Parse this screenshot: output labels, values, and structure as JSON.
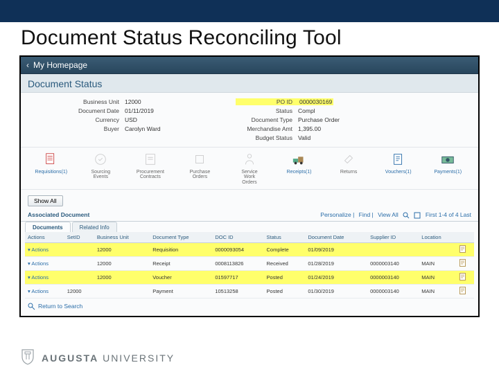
{
  "slide_title": "Document Status Reconciling Tool",
  "app": {
    "homepage_label": "My Homepage",
    "page_heading": "Document Status"
  },
  "fields": {
    "business_unit": {
      "label": "Business Unit",
      "value": "12000"
    },
    "document_date": {
      "label": "Document Date",
      "value": "01/11/2019"
    },
    "currency": {
      "label": "Currency",
      "value": "USD"
    },
    "buyer": {
      "label": "Buyer",
      "value": "Carolyn Ward"
    },
    "po_id": {
      "label": "PO ID",
      "value": "0000030169"
    },
    "status": {
      "label": "Status",
      "value": "Compl"
    },
    "document_type": {
      "label": "Document Type",
      "value": "Purchase Order"
    },
    "merch_amt": {
      "label": "Merchandise Amt",
      "value": "1,395.00"
    },
    "budget_status": {
      "label": "Budget Status",
      "value": "Valid"
    }
  },
  "flow": [
    {
      "label": "Requisitions(1)",
      "active": true,
      "dim": false
    },
    {
      "label": "Sourcing\nEvents",
      "active": false,
      "dim": true
    },
    {
      "label": "Procurement\nContracts",
      "active": false,
      "dim": true
    },
    {
      "label": "Purchase\nOrders",
      "active": false,
      "dim": true
    },
    {
      "label": "Service\nWork\nOrders",
      "active": false,
      "dim": true
    },
    {
      "label": "Receipts(1)",
      "active": true,
      "dim": false
    },
    {
      "label": "Returns",
      "active": false,
      "dim": true
    },
    {
      "label": "Vouchers(1)",
      "active": true,
      "dim": false
    },
    {
      "label": "Payments(1)",
      "active": true,
      "dim": false
    }
  ],
  "buttons": {
    "show_all": "Show All",
    "return_to_search": "Return to Search"
  },
  "assoc": {
    "title": "Associated Document",
    "tools": {
      "personalize": "Personalize",
      "find": "Find",
      "view_all": "View All",
      "pager": "First   1-4 of 4   Last"
    }
  },
  "tabs": {
    "documents": "Documents",
    "related_info": "Related Info"
  },
  "table": {
    "headers": [
      "Actions",
      "SetID",
      "Business Unit",
      "Document Type",
      "DOC ID",
      "Status",
      "Document Date",
      "Supplier ID",
      "Location"
    ],
    "rows": [
      {
        "hl": true,
        "cells": [
          "Actions",
          "",
          "12000",
          "Requisition",
          "0000093054",
          "Complete",
          "01/09/2019",
          "",
          ""
        ]
      },
      {
        "hl": false,
        "cells": [
          "Actions",
          "",
          "12000",
          "Receipt",
          "0008113826",
          "Received",
          "01/28/2019",
          "0000003140",
          "MAIN"
        ]
      },
      {
        "hl": true,
        "cells": [
          "Actions",
          "",
          "12000",
          "Voucher",
          "01597717",
          "Posted",
          "01/24/2019",
          "0000003140",
          "MAIN"
        ]
      },
      {
        "hl": false,
        "cells": [
          "Actions",
          "12000",
          "",
          "Payment",
          "10513258",
          "Posted",
          "01/30/2019",
          "0000003140",
          "MAIN"
        ]
      }
    ]
  },
  "footer": {
    "brand1": "AUGUSTA",
    "brand2": "UNIVERSITY"
  }
}
